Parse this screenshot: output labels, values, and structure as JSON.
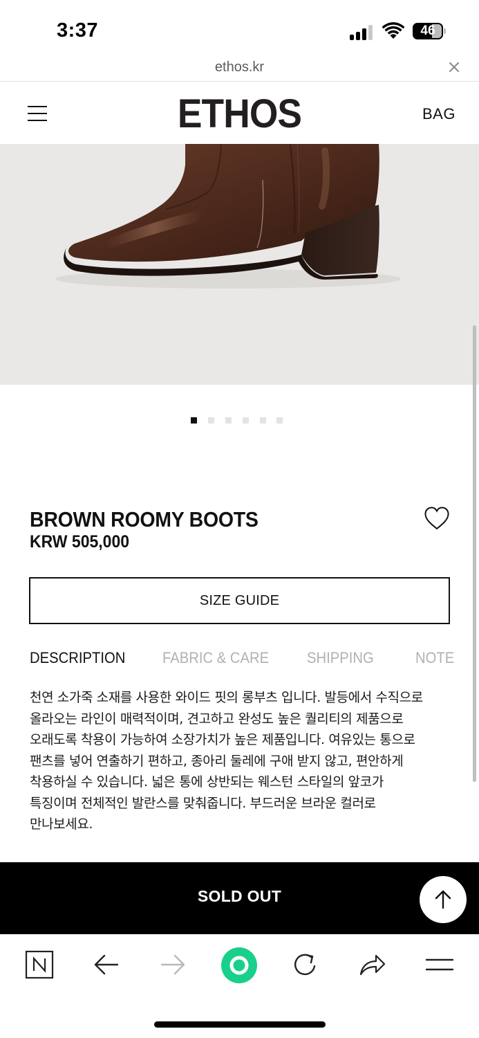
{
  "status_bar": {
    "time": "3:37",
    "battery_level": "46",
    "cellular_bars": 3,
    "icons": [
      "cellular-signal-icon",
      "wifi-icon",
      "battery-icon"
    ]
  },
  "browser": {
    "url": "ethos.kr",
    "close_icon": "close-icon"
  },
  "header": {
    "logo": "ETHOS",
    "bag_label": "BAG",
    "menu_icon": "hamburger-menu-icon"
  },
  "gallery": {
    "image": "brown-leather-western-boot-photo",
    "slide_count": 6,
    "active_slide": 1
  },
  "product": {
    "name": "BROWN ROOMY BOOTS",
    "price": "KRW 505,000",
    "wishlist_icon": "heart-outline-icon",
    "size_guide_label": "SIZE GUIDE"
  },
  "tabs": [
    {
      "label": "DESCRIPTION",
      "active": true
    },
    {
      "label": "FABRIC & CARE",
      "active": false
    },
    {
      "label": "SHIPPING",
      "active": false
    },
    {
      "label": "NOTE",
      "active": false
    }
  ],
  "description_lines": [
    "천연 소가죽 소재를 사용한 와이드 핏의 롱부츠 입니다. 발등에서 수직으로",
    "올라오는 라인이 매력적이며, 견고하고 완성도 높은 퀄리티의 제품으로",
    "오래도록 착용이 가능하여 소장가치가 높은 제품입니다. 여유있는 통으로",
    "팬츠를 넣어 연출하기 편하고, 종아리 둘레에 구애 받지 않고, 편안하게",
    "착용하실 수 있습니다. 넓은 통에 상반되는 웨스턴 스타일의 앞코가",
    "특징이며 전체적인 발란스를 맞춰줍니다. 부드러운 브라운 컬러로",
    "만나보세요."
  ],
  "cta": {
    "label": "SOLD OUT",
    "scroll_top_icon": "arrow-up-icon"
  },
  "toolbar": {
    "icons": [
      "naver-home-icon",
      "back-arrow-icon",
      "forward-arrow-icon",
      "green-dot-icon",
      "reload-icon",
      "share-icon",
      "menu-lines-icon"
    ]
  },
  "colors": {
    "hero_bg": "#e9e8e6",
    "boot": "#4a2a1e",
    "soldout_bg": "#000000",
    "accent_green": "#19d08a",
    "inactive_tab": "#b1b1b1"
  }
}
